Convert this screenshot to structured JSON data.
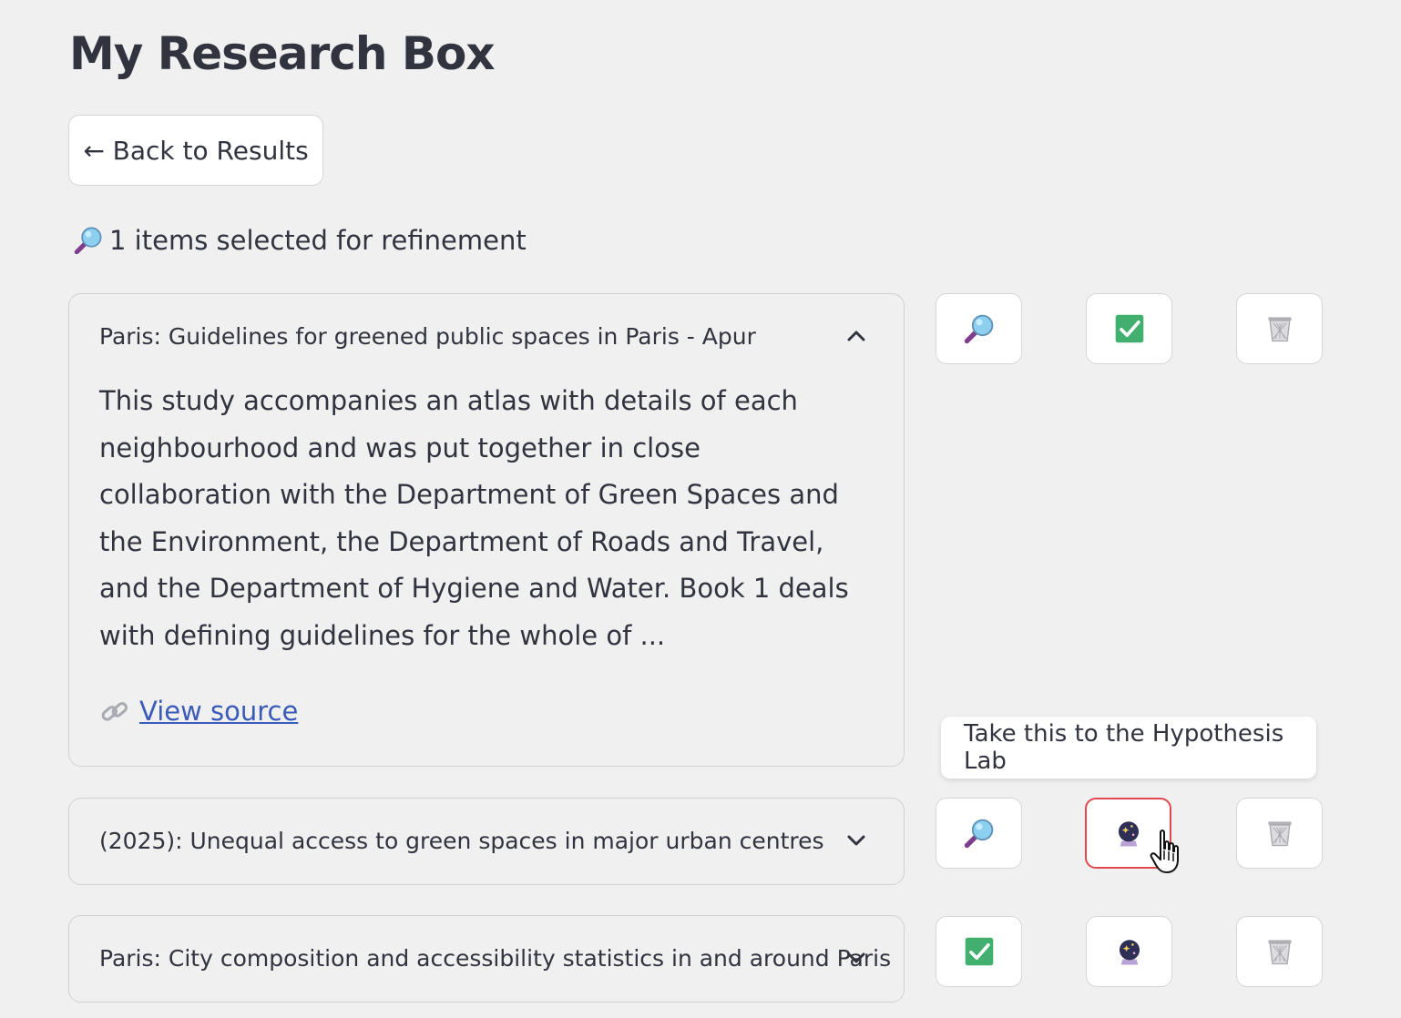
{
  "page": {
    "title": "My Research Box",
    "back_button_label": "← Back to Results",
    "selected_summary": "1 items selected for refinement"
  },
  "items": [
    {
      "title": "Paris: Guidelines for greened public spaces in Paris - Apur",
      "expanded": true,
      "description": "This study accompanies an atlas with details of each neighbourhood and was put together in close collaboration with the Department of Green Spaces and the Environment, the Department of Roads and Travel, and the Department of Hygiene and Water. Book 1 deals with defining guidelines for the whole of ...",
      "source_link_label": "View source",
      "actions": [
        "magnifier-icon",
        "check-box-icon",
        "trash-can-icon"
      ]
    },
    {
      "title": "(2025): Unequal access to green spaces in major urban centres",
      "expanded": false,
      "actions": [
        "magnifier-icon",
        "crystal-ball-icon",
        "trash-can-icon"
      ]
    },
    {
      "title": "Paris: City composition and accessibility statistics in and around Paris",
      "expanded": false,
      "actions": [
        "check-box-icon",
        "crystal-ball-icon",
        "trash-can-icon"
      ]
    }
  ],
  "tooltip": {
    "text": "Take this to the Hypothesis Lab"
  },
  "colors": {
    "background": "#f0f0f0",
    "text": "#31333f",
    "link": "#3a5bb8",
    "active_border": "#e0484e",
    "check_green": "#3cb371"
  }
}
